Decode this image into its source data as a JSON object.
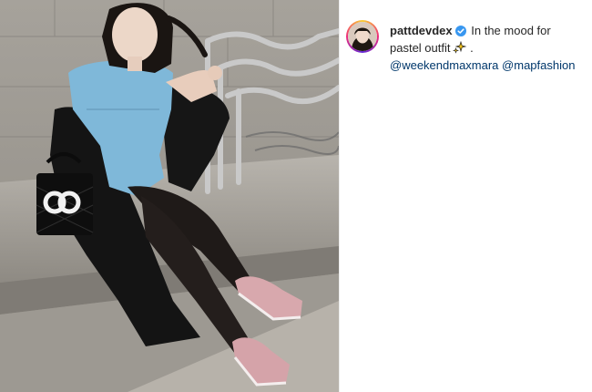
{
  "post": {
    "username": "pattdevdex",
    "caption_main": "In the mood for pastel outfit",
    "caption_after_emoji": " .",
    "mentions": [
      "@weekendmaxmara",
      "@mapfashion"
    ],
    "emoji_icon": "sparkles-icon",
    "verified_icon": "verified-badge-icon"
  },
  "colors": {
    "mention": "#00376b",
    "verified": "#3897f0",
    "text": "#262626"
  }
}
